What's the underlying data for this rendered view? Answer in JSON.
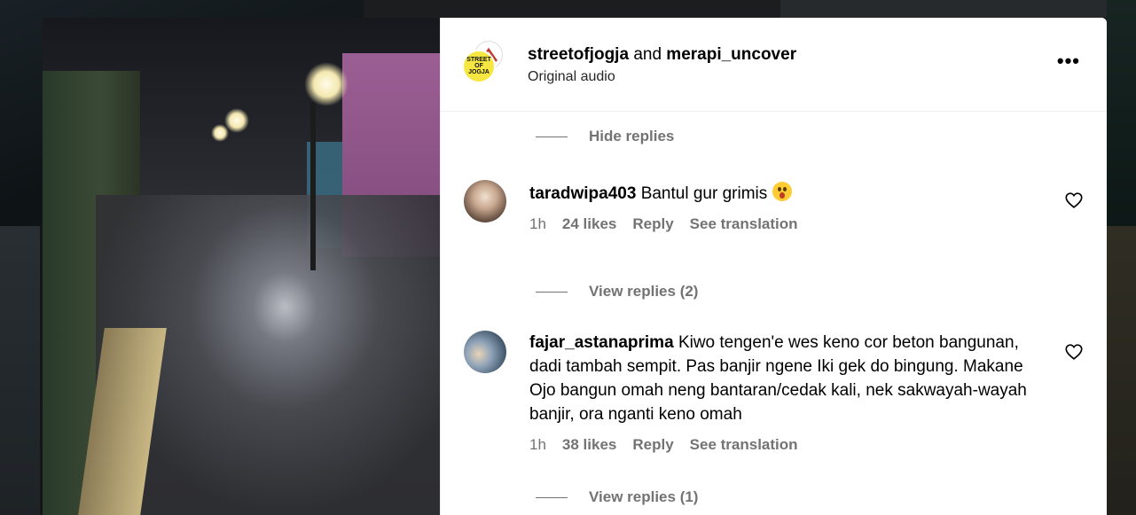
{
  "post": {
    "author": "streetofjogja",
    "joiner": "and",
    "collaborator": "merapi_uncover",
    "audio": "Original audio",
    "avatar_text": "STREET OF JOGJA"
  },
  "comments_section": {
    "hide_replies": "Hide replies",
    "comments": [
      {
        "username": "taradwipa403",
        "text": "Bantul gur grimis",
        "emoji": "😮",
        "time": "1h",
        "likes": "24 likes",
        "reply": "Reply",
        "translate": "See translation",
        "view_replies": "View replies (2)"
      },
      {
        "username": "fajar_astanaprima",
        "text": "Kiwo tengen'e wes keno cor beton bangunan, dadi tambah sempit. Pas banjir ngene Iki gek do bingung. Makane Ojo bangun omah neng bantaran/cedak kali, nek sakwayah-wayah banjir, ora nganti keno omah",
        "time": "1h",
        "likes": "38 likes",
        "reply": "Reply",
        "translate": "See translation",
        "view_replies": "View replies (1)"
      }
    ]
  },
  "colors": {
    "muted": "#737373",
    "avatar_yellow": "#f5e642"
  },
  "icons": {
    "more": "more-horizontal-icon",
    "like": "heart-outline-icon"
  }
}
